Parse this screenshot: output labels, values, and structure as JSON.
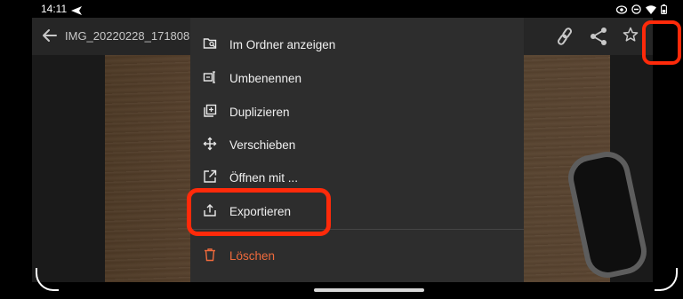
{
  "status_bar": {
    "time": "14:11"
  },
  "app_bar": {
    "file_name": "IMG_20220228_171808"
  },
  "menu": {
    "items": [
      {
        "label": "Im Ordner anzeigen",
        "icon": "folder-search-icon"
      },
      {
        "label": "Umbenennen",
        "icon": "rename-icon"
      },
      {
        "label": "Duplizieren",
        "icon": "duplicate-icon"
      },
      {
        "label": "Verschieben",
        "icon": "move-icon"
      },
      {
        "label": "Öffnen mit ...",
        "icon": "open-external-icon"
      },
      {
        "label": "Exportieren",
        "icon": "export-icon"
      },
      {
        "label": "Löschen",
        "icon": "trash-icon"
      }
    ]
  },
  "colors": {
    "highlight": "#ff2a0a",
    "danger": "#ef6a3c",
    "menu_bg": "#2d2d2d",
    "app_bar_bg": "#262626"
  }
}
